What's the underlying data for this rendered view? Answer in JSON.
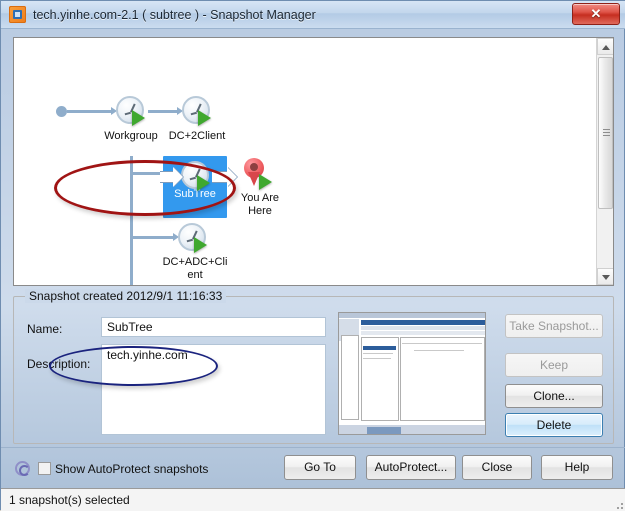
{
  "window": {
    "title": "tech.yinhe.com-2.1 ( subtree )  - Snapshot Manager",
    "close_label": "✕",
    "app_icon": "vmware-app-icon"
  },
  "tree": {
    "nodes": [
      {
        "label": "Workgroup"
      },
      {
        "label": "DC+2Client"
      },
      {
        "label": "SubTree",
        "selected": true
      },
      {
        "label": "DC+ADC+Cli"
      },
      {
        "label": "ent"
      },
      {
        "label": ""
      },
      {
        "label": ""
      }
    ],
    "you_are_here": {
      "line1": "You Are",
      "line2": "Here"
    }
  },
  "details": {
    "group_title": "Snapshot created 2012/9/1 11:16:33",
    "name_label": "Name:",
    "name_value": "SubTree",
    "description_label": "Description:",
    "description_value": "tech.yinhe.com"
  },
  "side_buttons": [
    {
      "label": "Take Snapshot...",
      "state": "disabled"
    },
    {
      "label": "Keep",
      "state": "disabled"
    },
    {
      "label": "Clone...",
      "state": "normal"
    },
    {
      "label": "Delete",
      "state": "default"
    }
  ],
  "bottom_buttons": [
    {
      "label": "Go To"
    },
    {
      "label": "AutoProtect..."
    },
    {
      "label": "Close"
    },
    {
      "label": "Help"
    }
  ],
  "autoprotect": {
    "checkbox_label": "Show AutoProtect snapshots",
    "checked": false
  },
  "status": {
    "text": "1 snapshot(s) selected"
  },
  "colors": {
    "selection_blue": "#3399ee",
    "annotation_red": "#a01414",
    "annotation_navy": "#1a237e",
    "play_green": "#3fa82f",
    "pin_red": "#d8474b",
    "connector": "#8fadcb"
  }
}
